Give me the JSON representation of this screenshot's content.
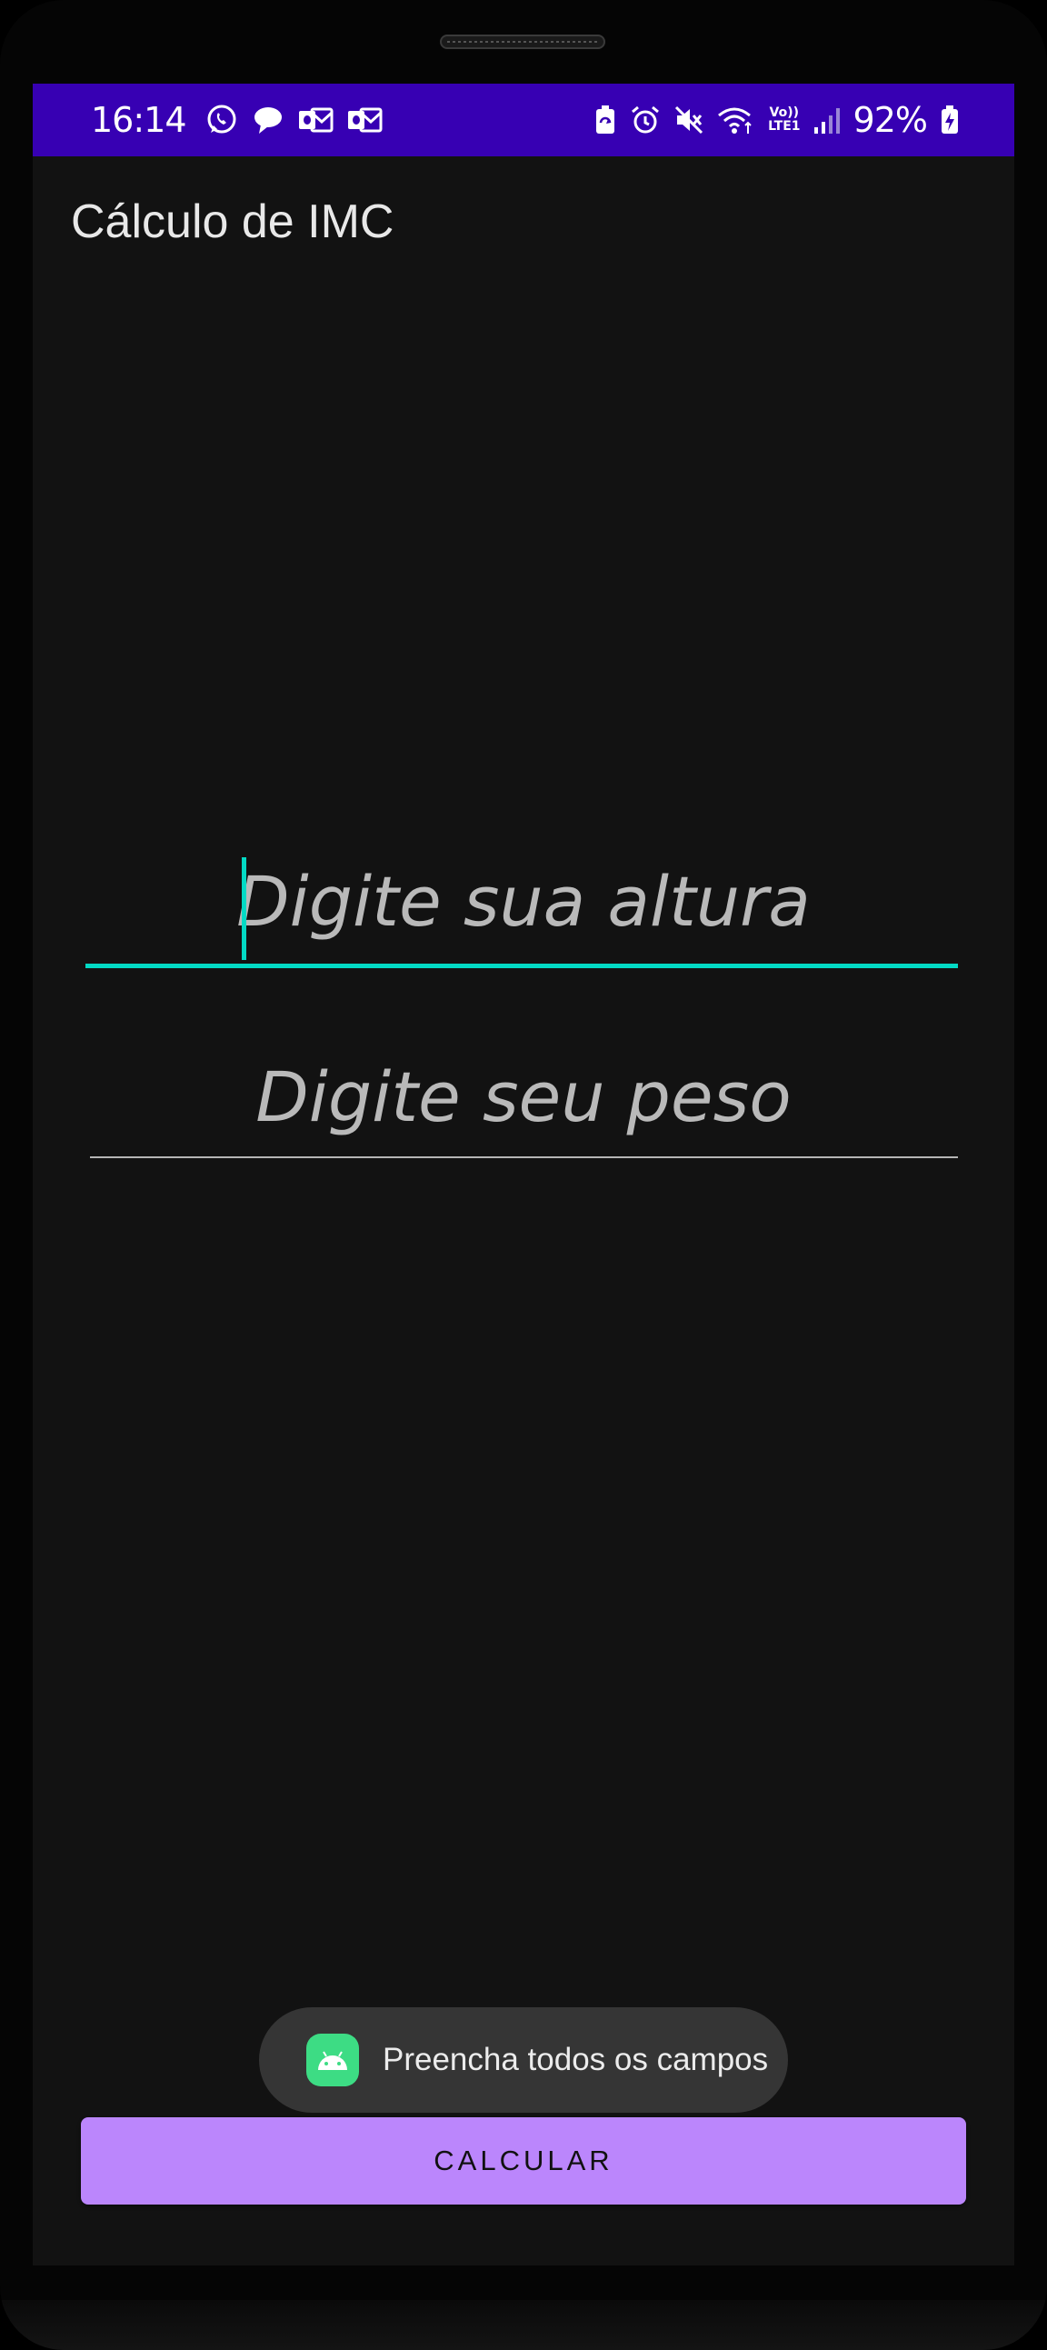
{
  "status_bar": {
    "time": "16:14",
    "left_icons": [
      "whatsapp-icon",
      "chat-bubble-icon",
      "outlook-icon",
      "outlook-icon"
    ],
    "right_icons": [
      "battery-saver-icon",
      "alarm-icon",
      "mute-icon",
      "wifi-icon",
      "volte-icon",
      "signal-icon"
    ],
    "network_top": "Vo))",
    "network_bottom": "LTE1",
    "battery": "92%",
    "background": "#3700b3"
  },
  "app": {
    "title": "Cálculo de IMC"
  },
  "form": {
    "height_placeholder": "Digite sua altura",
    "weight_placeholder": "Digite seu peso",
    "accent": "#03dac5"
  },
  "toast": {
    "icon": "android-icon",
    "message": "Preencha todos os campos"
  },
  "button": {
    "label": "CALCULAR",
    "background": "#bb86fc"
  }
}
